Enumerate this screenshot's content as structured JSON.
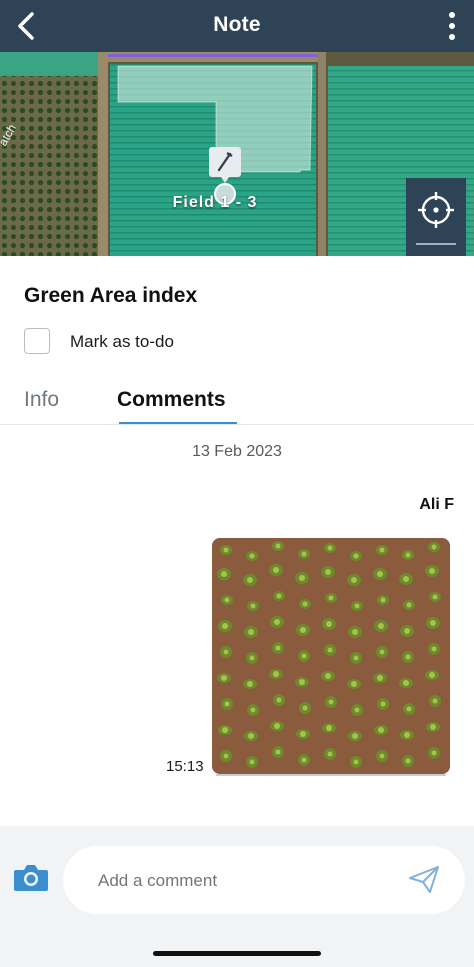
{
  "header": {
    "title": "Note"
  },
  "icons": {
    "back": "chevron-left-icon",
    "more": "more-vertical-icon",
    "pin": "pencil-pin-icon",
    "locate": "crosshair-icon",
    "camera": "camera-icon",
    "send": "send-icon"
  },
  "map": {
    "field_label": "Field 1 - 3",
    "edge_text": "atch"
  },
  "note": {
    "title": "Green Area index",
    "todo_label": "Mark as to-do",
    "todo_checked": false
  },
  "tabs": [
    {
      "label": "Info",
      "active": false
    },
    {
      "label": "Comments",
      "active": true
    }
  ],
  "comments": {
    "date": "13 Feb 2023",
    "items": [
      {
        "author": "Ali F",
        "time": "15:13",
        "type": "photo"
      }
    ]
  },
  "composer": {
    "placeholder": "Add a comment"
  },
  "colors": {
    "header_bg": "#2f4357",
    "accent": "#3a8fd0",
    "field_green": "#2aa487"
  }
}
